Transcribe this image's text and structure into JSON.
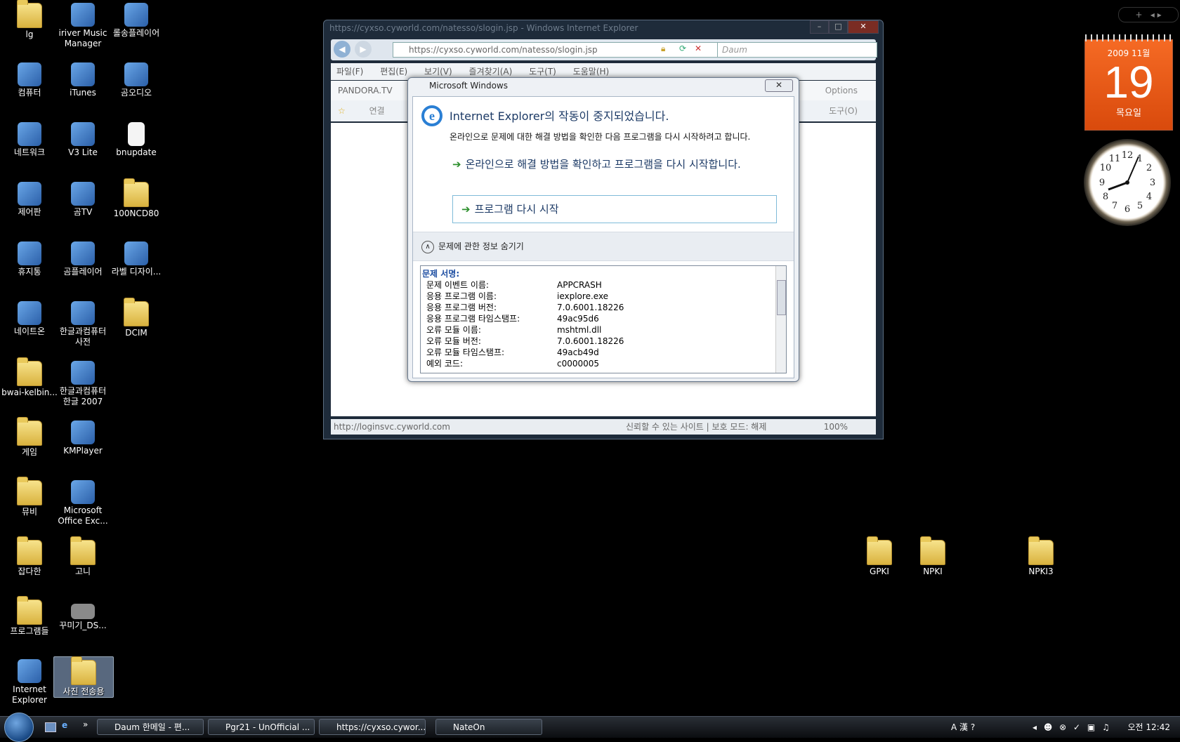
{
  "desktop": {
    "icons": [
      {
        "label": "lg",
        "kind": "folder"
      },
      {
        "label": "iriver Music Manager",
        "kind": "app"
      },
      {
        "label": "롤송플레이어",
        "kind": "app"
      },
      {
        "label": "컴퓨터",
        "kind": "app"
      },
      {
        "label": "iTunes",
        "kind": "app"
      },
      {
        "label": "곰오디오",
        "kind": "app"
      },
      {
        "label": "네트워크",
        "kind": "app"
      },
      {
        "label": "V3 Lite",
        "kind": "app"
      },
      {
        "label": "bnupdate",
        "kind": "file"
      },
      {
        "label": "제어판",
        "kind": "app"
      },
      {
        "label": "곰TV",
        "kind": "app"
      },
      {
        "label": "100NCD80",
        "kind": "folder"
      },
      {
        "label": "휴지통",
        "kind": "app"
      },
      {
        "label": "곰플레이어",
        "kind": "app"
      },
      {
        "label": "라벨 디자이...",
        "kind": "app"
      },
      {
        "label": "네이트온",
        "kind": "app"
      },
      {
        "label": "한글과컴퓨터 사전",
        "kind": "app"
      },
      {
        "label": "DCIM",
        "kind": "folder"
      },
      {
        "label": "bwai-kelbin...",
        "kind": "folder"
      },
      {
        "label": "한글과컴퓨터 한글 2007",
        "kind": "app"
      },
      {
        "label": "게임",
        "kind": "folder"
      },
      {
        "label": "KMPlayer",
        "kind": "app"
      },
      {
        "label": "뮤비",
        "kind": "folder"
      },
      {
        "label": "Microsoft Office Exc...",
        "kind": "app"
      },
      {
        "label": "잡다한",
        "kind": "folder"
      },
      {
        "label": "고니",
        "kind": "folder"
      },
      {
        "label": "프로그램들",
        "kind": "folder"
      },
      {
        "label": "꾸미기_DS...",
        "kind": "image"
      },
      {
        "label": "Internet Explorer",
        "kind": "app"
      },
      {
        "label": "사진 전송용",
        "kind": "folder"
      },
      {
        "label": "GPKI",
        "kind": "folder"
      },
      {
        "label": "NPKI",
        "kind": "folder"
      },
      {
        "label": "NPKI3",
        "kind": "folder"
      }
    ]
  },
  "ie_window": {
    "title": "https://cyxso.cyworld.com/natesso/slogin.jsp - Windows Internet Explorer",
    "url": "https://cyxso.cyworld.com/natesso/slogin.jsp",
    "search_placeholder": "Daum",
    "menu": [
      "파일(F)",
      "편집(E)",
      "보기(V)",
      "즐겨찾기(A)",
      "도구(T)",
      "도움말(H)"
    ],
    "toolbar_brand": "PANDORA.TV",
    "toolbar_options": "Options",
    "tools_label": "도구(O)",
    "tab_label": "연결",
    "status_url": "http://loginsvc.cyworld.com",
    "status_zone": "신뢰할 수 있는 사이트 | 보호 모드: 해제",
    "zoom": "100%"
  },
  "dialog": {
    "title": "Microsoft Windows",
    "heading": "Internet Explorer의 작동이 중지되었습니다.",
    "subtext": "온라인으로 문제에 대한 해결 방법을 확인한 다음 프로그램을 다시 시작하려고 합니다.",
    "option1": "온라인으로 해결 방법을 확인하고 프로그램을 다시 시작합니다.",
    "option2": "프로그램 다시 시작",
    "details_toggle": "문제에 관한 정보 숨기기",
    "details_header": "문제 서명:",
    "details": [
      {
        "k": "문제 이벤트 이름:",
        "v": "APPCRASH"
      },
      {
        "k": "응용 프로그램 이름:",
        "v": "iexplore.exe"
      },
      {
        "k": "응용 프로그램 버전:",
        "v": "7.0.6001.18226"
      },
      {
        "k": "응용 프로그램 타임스탬프:",
        "v": "49ac95d6"
      },
      {
        "k": "오류 모듈 이름:",
        "v": "mshtml.dll"
      },
      {
        "k": "오류 모듈 버전:",
        "v": "7.0.6001.18226"
      },
      {
        "k": "오류 모듈 타임스탬프:",
        "v": "49acb49d"
      },
      {
        "k": "예외 코드:",
        "v": "c0000005"
      }
    ]
  },
  "taskbar": {
    "buttons": [
      "Daum 한메일 - 편...",
      "Pgr21 - UnOfficial ...",
      "https://cyxso.cywor...",
      "NateOn"
    ],
    "time": "오전 12:42"
  },
  "gadgets": {
    "calendar_month": "2009 11월",
    "calendar_day": "19",
    "calendar_weekday": "목요일"
  },
  "colors": {
    "accent": "#1c3a66",
    "calendar": "#e8581a",
    "link_green": "#2c8f2c"
  }
}
